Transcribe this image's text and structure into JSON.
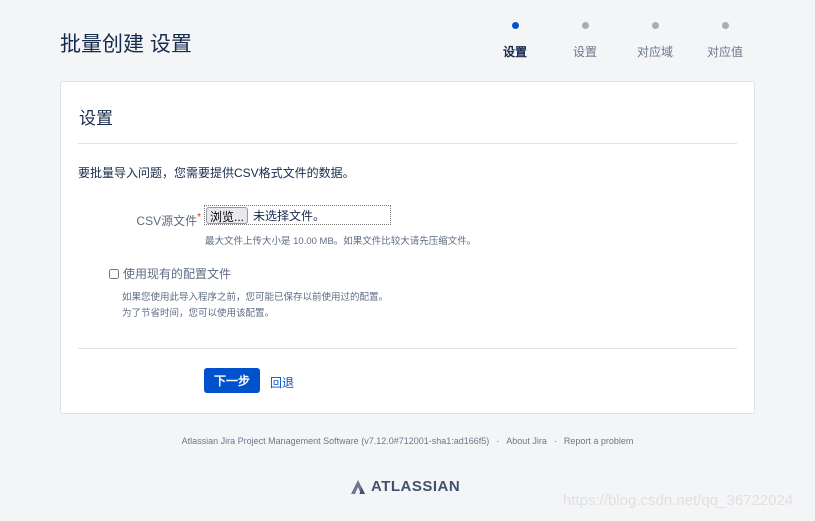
{
  "header": {
    "title": "批量创建 设置"
  },
  "steps": [
    {
      "label": "设置",
      "active": true
    },
    {
      "label": "设置"
    },
    {
      "label": "对应域"
    },
    {
      "label": "对应值"
    }
  ],
  "panel": {
    "heading": "设置",
    "intro": "要批量导入问题，您需要提供CSV格式文件的数据。",
    "csv_label": "CSV源文件",
    "required_mark": "*",
    "browse_label": "浏览...",
    "no_file": "未选择文件。",
    "size_hint": "最大文件上传大小是 10.00 MB。如果文件比较大请先压缩文件。",
    "use_config_label": "使用现有的配置文件",
    "config_hint_1": "如果您使用此导入程序之前，您可能已保存以前使用过的配置。",
    "config_hint_2": "为了节省时间，您可以使用该配置。",
    "next_label": "下一步",
    "back_label": "回退"
  },
  "footer": {
    "software": "Atlassian Jira Project Management Software (v7.12.0#712001-sha1:ad166f5)",
    "about": "About Jira",
    "report": "Report a problem",
    "sep": "·",
    "logo": "ATLASSIAN"
  },
  "watermark": "https://blog.csdn.net/qq_36722024",
  "colors": {
    "accent": "#0052cc",
    "text": "#172b4d",
    "bg": "#f4f5f7"
  }
}
